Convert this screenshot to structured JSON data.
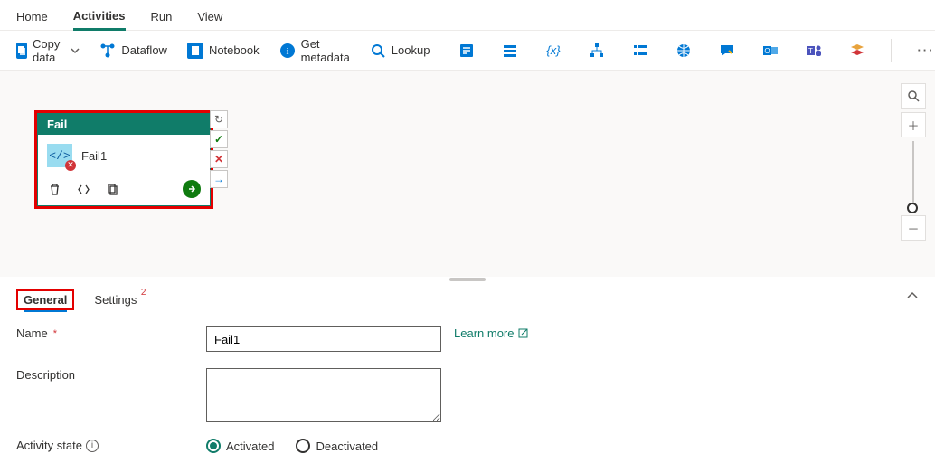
{
  "mainTabs": {
    "home": "Home",
    "activities": "Activities",
    "run": "Run",
    "view": "View"
  },
  "toolbar": {
    "copyData": "Copy data",
    "dataflow": "Dataflow",
    "notebook": "Notebook",
    "getMetadata": "Get metadata",
    "lookup": "Lookup"
  },
  "card": {
    "header": "Fail",
    "name": "Fail1"
  },
  "propTabs": {
    "general": "General",
    "settings": "Settings",
    "settingsBadge": "2"
  },
  "form": {
    "nameLabel": "Name",
    "nameValue": "Fail1",
    "learnMore": "Learn more",
    "descLabel": "Description",
    "descValue": "",
    "stateLabel": "Activity state",
    "activated": "Activated",
    "deactivated": "Deactivated"
  }
}
